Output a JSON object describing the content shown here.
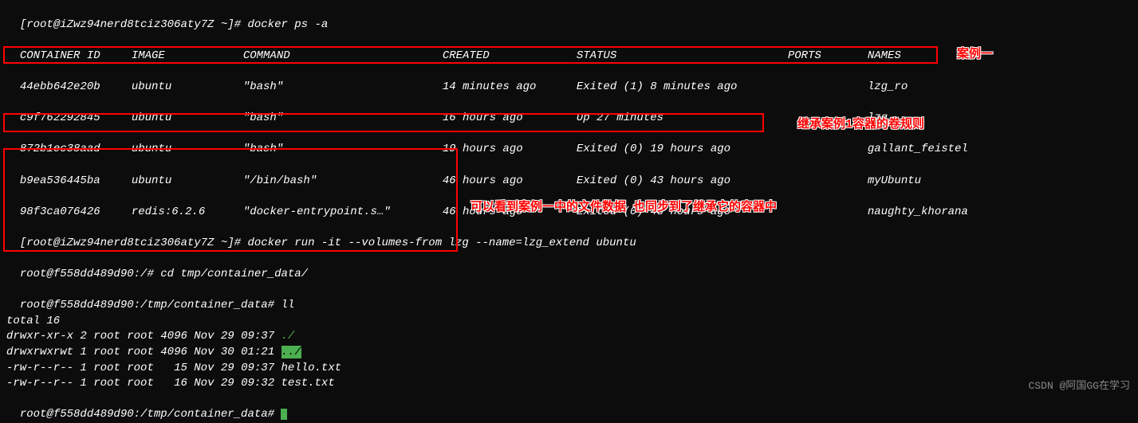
{
  "prompt1": {
    "user_host": "[root@iZwz94nerd8tciz306aty7Z ~]#",
    "command": "docker ps -a"
  },
  "table": {
    "headers": {
      "container_id": "CONTAINER ID",
      "image": "IMAGE",
      "command": "COMMAND",
      "created": "CREATED",
      "status": "STATUS",
      "ports": "PORTS",
      "names": "NAMES"
    },
    "rows": [
      {
        "id": "44ebb642e20b",
        "image": "ubuntu",
        "command": "\"bash\"",
        "created": "14 minutes ago",
        "status": "Exited (1) 8 minutes ago",
        "ports": "",
        "names": "lzg_ro"
      },
      {
        "id": "c9f762292845",
        "image": "ubuntu",
        "command": "\"bash\"",
        "created": "16 hours ago",
        "status": "Up 27 minutes",
        "ports": "",
        "names": "lzg"
      },
      {
        "id": "872b1ec38aad",
        "image": "ubuntu",
        "command": "\"bash\"",
        "created": "19 hours ago",
        "status": "Exited (0) 19 hours ago",
        "ports": "",
        "names": "gallant_feistel"
      },
      {
        "id": "b9ea536445ba",
        "image": "ubuntu",
        "command": "\"/bin/bash\"",
        "created": "46 hours ago",
        "status": "Exited (0) 43 hours ago",
        "ports": "",
        "names": "myUbuntu"
      },
      {
        "id": "98f3ca076426",
        "image": "redis:6.2.6",
        "command": "\"docker-entrypoint.s…\"",
        "created": "46 hours ago",
        "status": "Exited (0) 43 hours ago",
        "ports": "",
        "names": "naughty_khorana"
      }
    ]
  },
  "prompt2": {
    "user_host": "[root@iZwz94nerd8tciz306aty7Z ~]#",
    "command": "docker run -it --volumes-from lzg --name=lzg_extend ubuntu"
  },
  "inner_prompt1": {
    "user_host": "root@f558dd489d90:/#",
    "command": "cd tmp/container_data/"
  },
  "inner_prompt2": {
    "user_host": "root@f558dd489d90:/tmp/container_data#",
    "command": "ll"
  },
  "ll_output": {
    "total": "total 16",
    "rows": [
      {
        "perms": "drwxr-xr-x",
        "links": "2",
        "owner": "root",
        "group": "root",
        "size": "4096",
        "date": "Nov 29 09:37",
        "name": "./",
        "highlight": false
      },
      {
        "perms": "drwxrwxrwt",
        "links": "1",
        "owner": "root",
        "group": "root",
        "size": "4096",
        "date": "Nov 30 01:21",
        "name": "../",
        "highlight": true
      },
      {
        "perms": "-rw-r--r--",
        "links": "1",
        "owner": "root",
        "group": "root",
        "size": "  15",
        "date": "Nov 29 09:37",
        "name": "hello.txt",
        "highlight": false
      },
      {
        "perms": "-rw-r--r--",
        "links": "1",
        "owner": "root",
        "group": "root",
        "size": "  16",
        "date": "Nov 29 09:32",
        "name": "test.txt",
        "highlight": false
      }
    ]
  },
  "final_prompt": {
    "user_host": "root@f558dd489d90:/tmp/container_data#"
  },
  "annotations": {
    "case1": "案例一",
    "inherit": "继承案例1容器的卷规则",
    "observe": "可以看到案例一中的文件数据  也同步到了继承它的容器中"
  },
  "watermark": "CSDN @阿国GG在学习"
}
